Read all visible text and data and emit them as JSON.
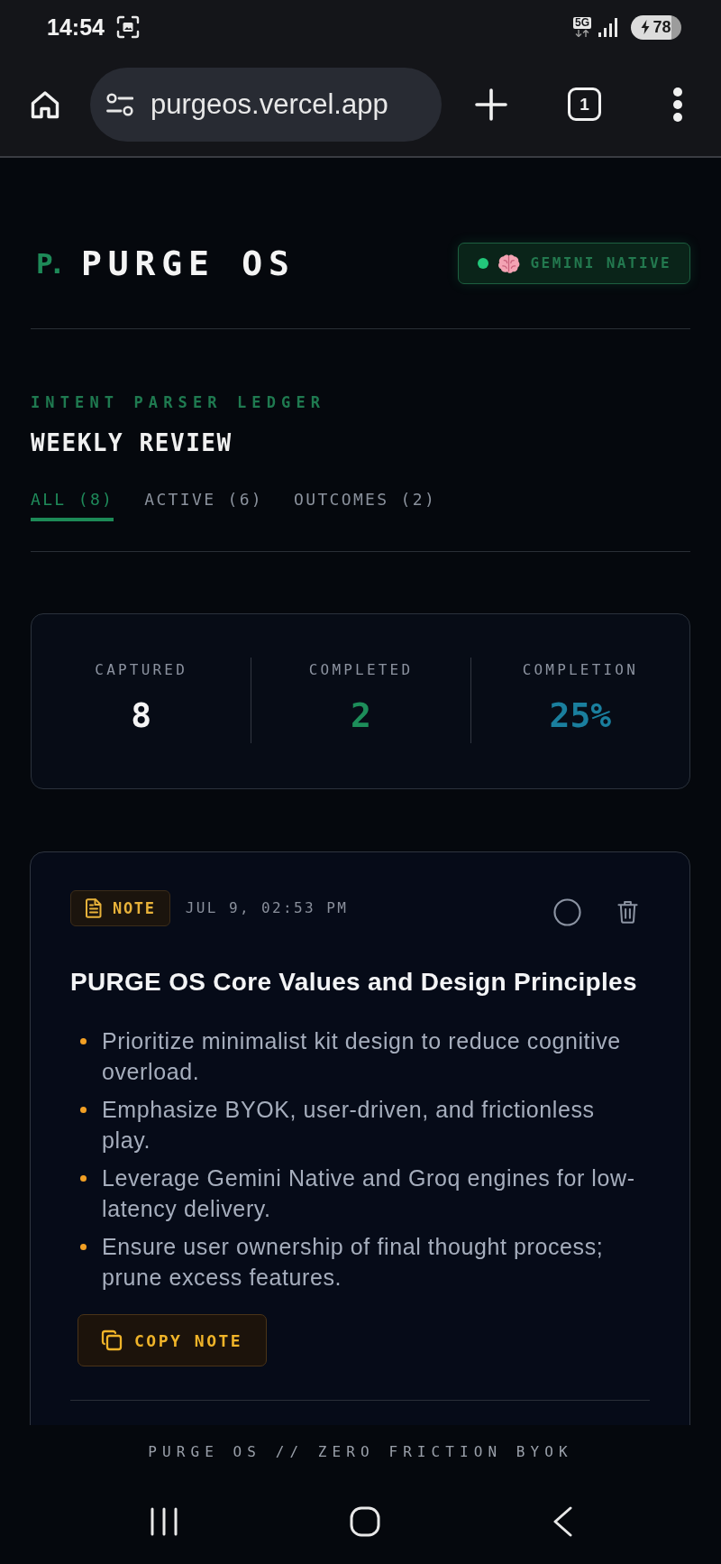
{
  "status_bar": {
    "time": "14:54",
    "network": "5G",
    "battery": "78",
    "charging": true
  },
  "browser": {
    "url": "purgeos.vercel.app",
    "tab_count": "1"
  },
  "header": {
    "logo": "P.",
    "brand": "PURGE OS",
    "engine": {
      "label": "GEMINI NATIVE",
      "online": true
    }
  },
  "section": {
    "eyebrow": "INTENT PARSER LEDGER",
    "title": "WEEKLY REVIEW"
  },
  "tabs": [
    {
      "label": "ALL (8)",
      "selected": true
    },
    {
      "label": "ACTIVE (6)",
      "selected": false
    },
    {
      "label": "OUTCOMES (2)",
      "selected": false
    }
  ],
  "stats": [
    {
      "label": "CAPTURED",
      "value": "8",
      "kind": "total"
    },
    {
      "label": "COMPLETED",
      "value": "2",
      "kind": "done"
    },
    {
      "label": "COMPLETION",
      "value": "25%",
      "kind": "rate"
    }
  ],
  "entries": [
    {
      "kind": "note",
      "type_label": "NOTE",
      "date": "JUL 9, 02:53 PM",
      "done": false,
      "title": "PURGE OS Core Values and Design Principles",
      "bullets": [
        "Prioritize minimalist kit design to reduce cognitive overload.",
        "Emphasize BYOK, user-driven, and frictionless play.",
        "Leverage Gemini Native and Groq engines for low-latency delivery.",
        "Ensure user ownership of final thought process; prune excess features."
      ],
      "action": "COPY NOTE"
    }
  ],
  "footer": "PURGE OS // ZERO FRICTION BYOK"
}
